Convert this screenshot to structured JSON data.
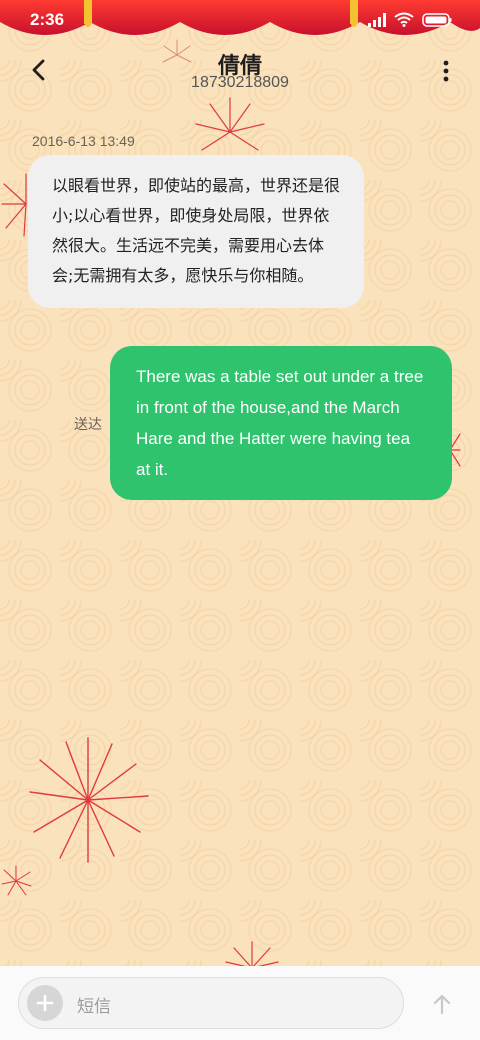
{
  "status_bar": {
    "time": "2:36"
  },
  "header": {
    "contact_name": "倩倩",
    "phone_number": "18730218809"
  },
  "messages": [
    {
      "direction": "incoming",
      "timestamp": "2016-6-13 13:49",
      "text": "以眼看世界，即使站的最高，世界还是很小;以心看世界，即使身处局限，世界依然很大。生活远不完美，需要用心去体会;无需拥有太多，愿快乐与你相随。"
    },
    {
      "direction": "outgoing",
      "status": "送达",
      "text": "There was a table set out under a tree in front of the house,and the March Hare and the Hatter were having tea at it."
    }
  ],
  "composer": {
    "placeholder": "短信"
  },
  "icons": {
    "back": "chevron-left-icon",
    "more": "more-vertical-icon",
    "add": "plus-icon",
    "send": "arrow-up-icon",
    "signal": "signal-icon",
    "wifi": "wifi-icon",
    "battery": "battery-icon"
  },
  "colors": {
    "outgoing_bubble": "#2fc36d",
    "incoming_bubble": "#f0f0f0",
    "curtain": "#e02020",
    "background": "#fae2bd"
  }
}
